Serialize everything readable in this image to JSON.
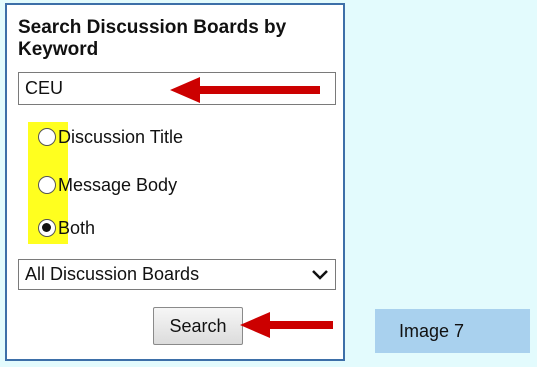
{
  "search_panel": {
    "heading": "Search Discussion Boards by Keyword",
    "keyword_input": {
      "value": "CEU"
    },
    "options": [
      {
        "label": "Discussion Title",
        "checked": false
      },
      {
        "label": "Message Body",
        "checked": false
      },
      {
        "label": "Both",
        "checked": true
      }
    ],
    "scope_select": {
      "selected": "All Discussion Boards"
    },
    "search_button_label": "Search"
  },
  "caption": "Image 7",
  "colors": {
    "background": "#e3fbfd",
    "panel_border": "#3d6fa8",
    "highlight": "#ffff1f",
    "arrow": "#cc0000",
    "caption_box": "#a9d1ee"
  },
  "icons": {
    "dropdown": "chevron-down-icon",
    "annotation": "red-arrow-icon"
  }
}
